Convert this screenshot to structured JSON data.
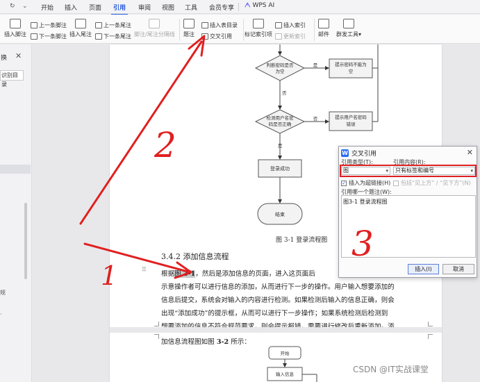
{
  "quick_access": {
    "redo_glyph": "↻",
    "dropdown_glyph": "⌄"
  },
  "tabs": [
    {
      "label": "开始",
      "active": false
    },
    {
      "label": "插入",
      "active": false
    },
    {
      "label": "页面",
      "active": false
    },
    {
      "label": "引用",
      "active": true
    },
    {
      "label": "审阅",
      "active": false
    },
    {
      "label": "视图",
      "active": false
    },
    {
      "label": "工具",
      "active": false
    },
    {
      "label": "会员专享",
      "active": false
    }
  ],
  "wps_ai": {
    "label": "WPS AI"
  },
  "ribbon": {
    "insert_footnote": "插入脚注",
    "prev_footnote": "上一条脚注",
    "next_footnote": "下一条脚注",
    "insert_endnote": "插入尾注",
    "prev_endnote": "上一条尾注",
    "next_endnote": "下一条尾注",
    "separator_line": "脚注/尾注分隔线",
    "caption": "题注",
    "insert_table_of_figures": "插入表目录",
    "cross_reference": "交叉引用",
    "mark_index_entry": "标记索引项",
    "insert_index": "插入索引",
    "update_index": "更新索引",
    "mail": "邮件",
    "mail_tools": "群发工具",
    "mail_tools_arrow": "▾"
  },
  "left_pane": {
    "title": "换",
    "close": "✕",
    "button": "识别目录",
    "small_1": "规",
    "small_2": "·"
  },
  "flowchart": {
    "decision_password": "判断密码是否\n为空",
    "label_yes_1": "是",
    "box_password_empty": "提示密码不能为\n空",
    "label_no_1": "否",
    "decision_check": "检测用户名密\n码是否正确",
    "label_no_2": "否",
    "box_error": "提示用户名密码\n错误",
    "label_yes_2": "是",
    "box_success": "登录成功",
    "end": "结束"
  },
  "document": {
    "figure_caption": "图 3-1  登录流程图",
    "drag_handle": "⠿",
    "heading": "3.4.2 添加信息流程",
    "para_line1_pre": "    根据",
    "para_line1_ref_pre": "图 ",
    "para_line1_ref_num": "3-1",
    "para_line1_post": "，然后是添加信息的页面，进入这页面后",
    "para_line2": "示意操作者可以进行信息的添加，从而进行下一步的操作。用户输入想要添加的",
    "para_line3": "信息后提交，系统会对输入的内容进行检测。如果检测后输入的信息正确，则会",
    "para_line4": "出现“添加成功”的提示框，从而可以进行下一步操作；如果系统检测后检测到",
    "para_line5": "想要添加的信息不符合规范要求，则会提示报错，需要进行修改后重新添加。添",
    "para_line6_pre": "加信息流程图如图 ",
    "para_line6_num": "3-2",
    "para_line6_post": " 所示：",
    "flow2_start": "开始",
    "flow2_input": "输入信息"
  },
  "dialog": {
    "logo": "W",
    "title": "交叉引用",
    "close": "✕",
    "ref_type_label": "引用类型(T):",
    "ref_type_value": "图",
    "ref_content_label": "引用内容(R):",
    "ref_content_value": "只有标签和编号",
    "dropdown_arrow": "▾",
    "insert_as_hyperlink": "插入为超链接(H)",
    "checkmark": "✓",
    "include_above_below": "包括“见上方” / “见下方”(N)",
    "which_caption_label": "引用哪一个题注(W):",
    "caption_items": [
      "图3-1 登录流程图"
    ],
    "insert_button": "插入(I)",
    "cancel_button": "取消"
  },
  "annotations": {
    "one": "1",
    "two": "2",
    "three": "3",
    "color": "#e02020"
  },
  "watermark": "CSDN @IT实战课堂"
}
